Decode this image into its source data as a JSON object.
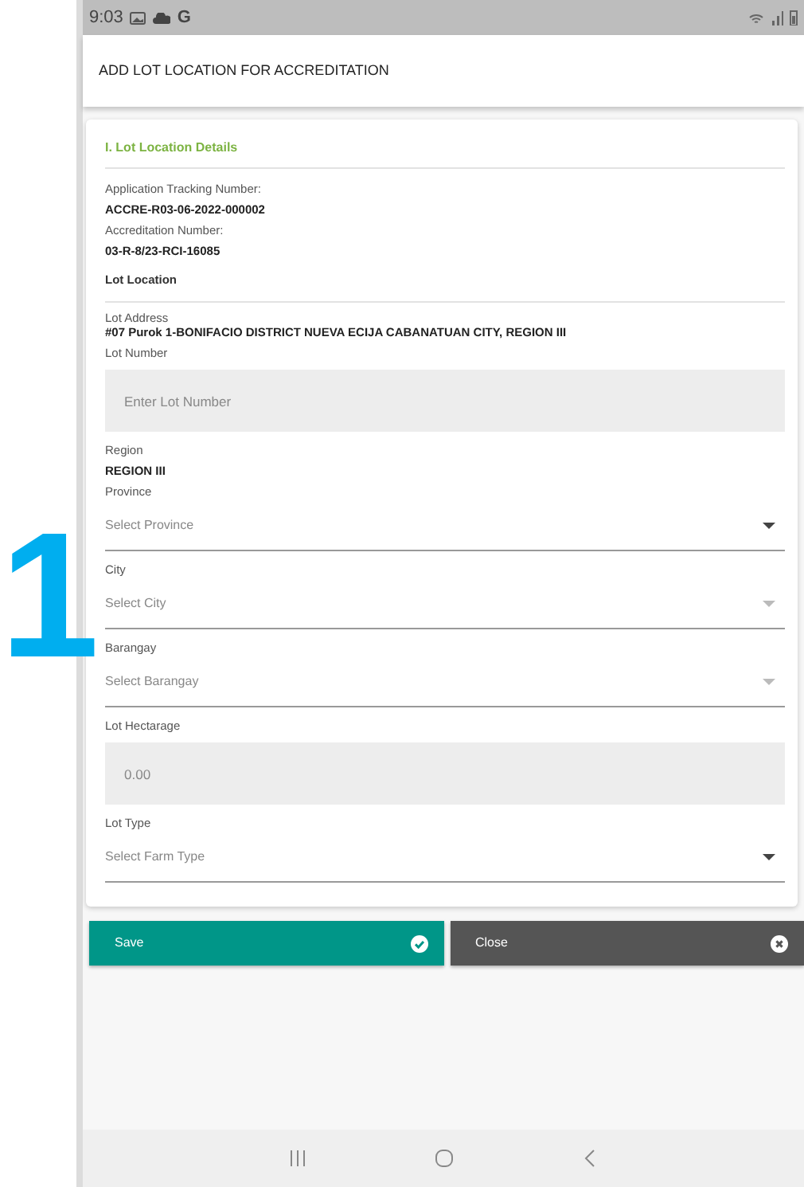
{
  "status_bar": {
    "time": "9:03",
    "letter": "G"
  },
  "header": {
    "title": "ADD LOT LOCATION FOR ACCREDITATION"
  },
  "card": {
    "section_title": "I. Lot Location Details",
    "items": [
      {
        "kind": "info",
        "label": "Application Tracking Number:",
        "value": "ACCRE-R03-06-2022-000002"
      },
      {
        "kind": "info",
        "label": "Accreditation Number:",
        "value": "03-R-8/23-RCI-16085"
      },
      {
        "kind": "subheading",
        "label": "Lot Location"
      },
      {
        "kind": "address",
        "label": "Lot Address",
        "value": "#07 Purok 1-BONIFACIO DISTRICT NUEVA ECIJA CABANATUAN CITY, REGION III"
      },
      {
        "kind": "input",
        "label": "Lot Number",
        "placeholder": "Enter Lot Number"
      },
      {
        "kind": "info",
        "label": "Region",
        "value": "REGION III"
      },
      {
        "kind": "select",
        "label": "Province",
        "placeholder": "Select Province",
        "disabled": false
      },
      {
        "kind": "select",
        "label": "City",
        "placeholder": "Select City",
        "disabled": true
      },
      {
        "kind": "select",
        "label": "Barangay",
        "placeholder": "Select Barangay",
        "disabled": true
      },
      {
        "kind": "input",
        "label": "Lot Hectarage",
        "placeholder": "0.00"
      },
      {
        "kind": "select",
        "label": "Lot Type",
        "placeholder": "Select Farm Type",
        "disabled": false
      }
    ]
  },
  "buttons": [
    {
      "kind": "save",
      "label": "Save"
    },
    {
      "kind": "close",
      "label": "Close"
    }
  ],
  "step_marker": "1"
}
